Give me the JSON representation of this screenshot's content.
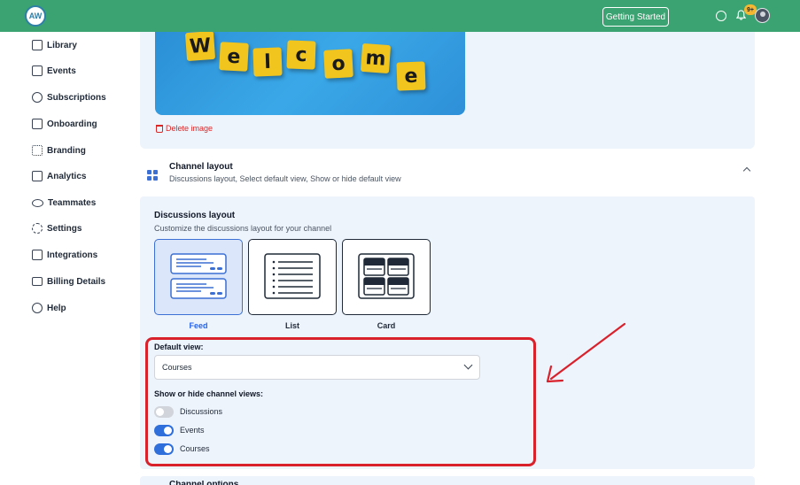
{
  "topbar": {
    "logo_text": "AW",
    "getting_started_label": "Getting Started",
    "notification_badge": "9+",
    "accent_color": "#3aa371"
  },
  "sidebar": {
    "items": [
      {
        "label": "Library",
        "icon": "book-icon"
      },
      {
        "label": "Events",
        "icon": "calendar-icon"
      },
      {
        "label": "Subscriptions",
        "icon": "dollar-icon"
      },
      {
        "label": "Onboarding",
        "icon": "checklist-icon"
      },
      {
        "label": "Branding",
        "icon": "branding-icon"
      },
      {
        "label": "Analytics",
        "icon": "chart-icon"
      },
      {
        "label": "Teammates",
        "icon": "people-icon"
      },
      {
        "label": "Settings",
        "icon": "gear-icon"
      },
      {
        "label": "Integrations",
        "icon": "code-icon"
      },
      {
        "label": "Billing Details",
        "icon": "card-icon"
      },
      {
        "label": "Help",
        "icon": "help-icon"
      }
    ]
  },
  "image_card": {
    "tiles": [
      "W",
      "e",
      "l",
      "c",
      "o",
      "m",
      "e"
    ],
    "delete_label": "Delete image"
  },
  "channel_layout": {
    "title": "Channel layout",
    "subtitle": "Discussions layout, Select default view, Show or hide default view"
  },
  "discussions_layout": {
    "title": "Discussions layout",
    "subtitle": "Customize the discussions layout for your channel",
    "options": [
      {
        "label": "Feed",
        "selected": true
      },
      {
        "label": "List",
        "selected": false
      },
      {
        "label": "Card",
        "selected": false
      }
    ]
  },
  "default_view": {
    "label": "Default view:",
    "value": "Courses"
  },
  "channel_views": {
    "label": "Show or hide channel views:",
    "toggles": [
      {
        "label": "Discussions",
        "on": false
      },
      {
        "label": "Events",
        "on": true
      },
      {
        "label": "Courses",
        "on": true
      }
    ]
  },
  "next_section": {
    "title": "Channel options"
  },
  "annotation": {
    "highlight_color": "#d9212c"
  }
}
